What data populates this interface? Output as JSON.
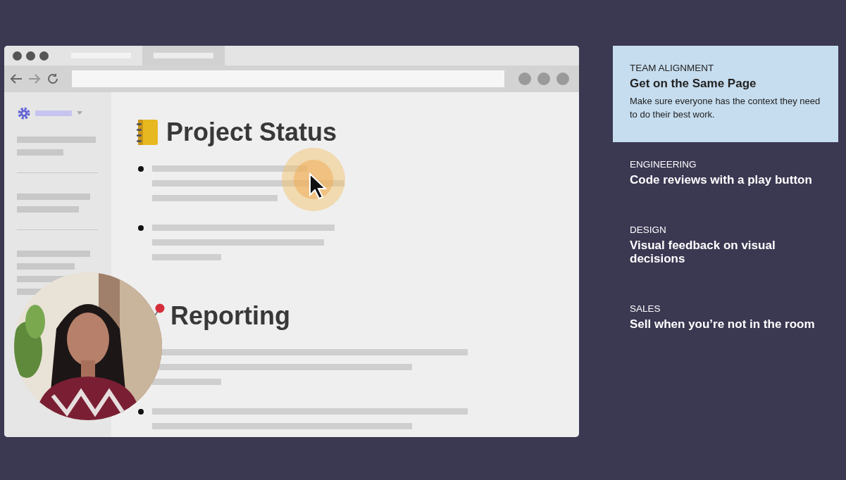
{
  "browser": {
    "sections": [
      {
        "heading": "Project Status"
      },
      {
        "heading": "Reporting"
      }
    ]
  },
  "cards": [
    {
      "category": "TEAM ALIGNMENT",
      "title": "Get on the Same Page",
      "description": "Make sure everyone has the context they need to do their best work.",
      "selected": true
    },
    {
      "category": "ENGINEERING",
      "title": "Code reviews with a play button",
      "selected": false
    },
    {
      "category": "DESIGN",
      "title": "Visual feedback on visual decisions",
      "selected": false
    },
    {
      "category": "SALES",
      "title": "Sell when you’re not in the room",
      "selected": false
    }
  ]
}
